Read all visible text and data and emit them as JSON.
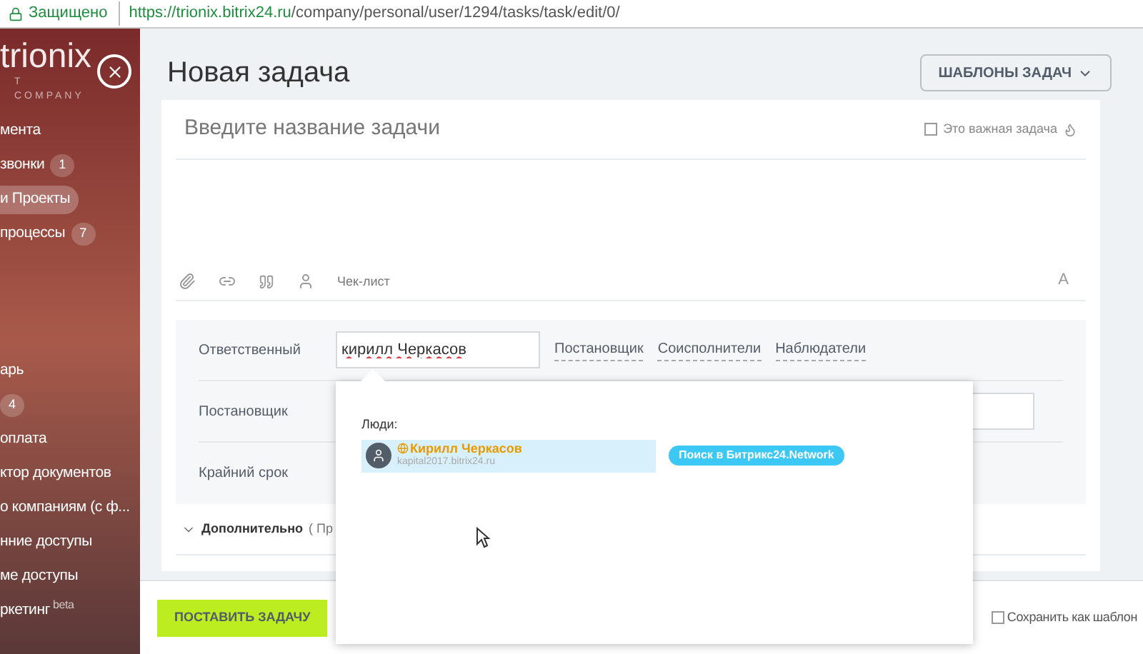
{
  "browser": {
    "secure_label": "Защищено",
    "url_host": "https://trionix.bitrix24.ru",
    "url_path": "/company/personal/user/1294/tasks/task/edit/0/"
  },
  "sidebar": {
    "logo": "trionix",
    "logo_sub": "T COMPANY",
    "items": [
      {
        "label": "мента",
        "selected": false
      },
      {
        "label": "звонки",
        "badge": "1",
        "selected": false
      },
      {
        "label": "и Проекты",
        "selected": true
      },
      {
        "label": "процессы",
        "badge": "7",
        "selected": false
      },
      {
        "label": "арь",
        "selected": false
      },
      {
        "badge": "4",
        "selected": false
      },
      {
        "label": "оплата",
        "selected": false
      },
      {
        "label": "ктор документов",
        "selected": false
      },
      {
        "label": "о компаниям (с ф...",
        "selected": false
      },
      {
        "label": "нние доступы",
        "selected": false
      },
      {
        "label": "ме доступы",
        "selected": false
      },
      {
        "label": "ркетинг",
        "sup": "beta",
        "selected": false
      }
    ]
  },
  "page": {
    "title": "Новая задача",
    "templates_button": "ШАБЛОНЫ ЗАДАЧ"
  },
  "task": {
    "title_placeholder": "Введите название задачи",
    "important": {
      "label": "Это важная задача",
      "checked": false
    },
    "toolbar_checklist": "Чек-лист",
    "format_button": "A",
    "fields": [
      {
        "label": "Ответственный",
        "value": "кирилл Черкасов",
        "links": [
          "Постановщик",
          "Соисполнители",
          "Наблюдатели"
        ]
      },
      {
        "label": "Постановщик"
      },
      {
        "label": "Крайний срок"
      }
    ],
    "more": {
      "label": "Дополнительно",
      "hint": "( Пр"
    }
  },
  "popup": {
    "section": "Люди:",
    "results": [
      {
        "name": "Кирилл Черкасов",
        "domain": "kapital2017.bitrix24.ru",
        "selected": true
      }
    ],
    "network_button": "Поиск в Битрикс24.Network"
  },
  "footer": {
    "submit": "ПОСТАВИТЬ ЗАДАЧУ",
    "save_template": {
      "label": "Сохранить как шаблон",
      "checked": false
    }
  }
}
